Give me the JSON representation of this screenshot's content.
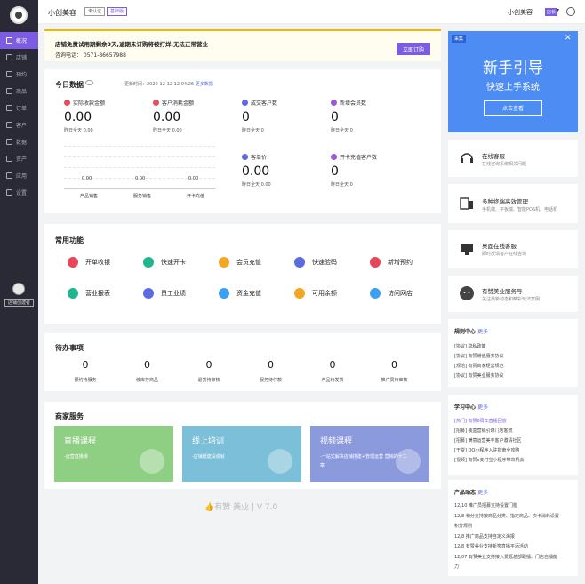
{
  "sidebar": {
    "items": [
      {
        "label": "概况"
      },
      {
        "label": "店铺"
      },
      {
        "label": "预约"
      },
      {
        "label": "商品"
      },
      {
        "label": "订单"
      },
      {
        "label": "客户"
      },
      {
        "label": "数据"
      },
      {
        "label": "资产"
      },
      {
        "label": "应用"
      },
      {
        "label": "设置"
      }
    ],
    "bottom_button": "店铺创建者"
  },
  "header": {
    "shop_name": "小创美容",
    "tag_unverified": "未认证",
    "tag_version": "基础版",
    "user_name": "小创美容",
    "user_badge": "店长"
  },
  "notice": {
    "text": "店铺免费试用期剩余3天,逾期未订购将被打烊,无法正常营业",
    "phone": "咨询电话： 0571-86657988",
    "button": "立即订购"
  },
  "today": {
    "title": "今日数据",
    "update_time": "更新时间：2020-12-12 12:04:26",
    "more": "更多数据",
    "metrics": [
      {
        "label": "实际收款金额",
        "value": "0.00",
        "sub": "昨日全天  0.00",
        "color": "#e84d5b"
      },
      {
        "label": "客户消耗金额",
        "value": "0.00",
        "sub": "昨日全天  0.00",
        "color": "#e84d5b"
      },
      {
        "label": "成交客户数",
        "value": "0",
        "sub": "昨日全天  0",
        "color": "#5b6be0"
      },
      {
        "label": "新增会员数",
        "value": "0",
        "sub": "昨日全天  0",
        "color": "#9b59d6"
      },
      {
        "label": "客单价",
        "value": "0.00",
        "sub": "昨日全天  0.00",
        "color": "#5b6be0"
      },
      {
        "label": "开卡充值客户数",
        "value": "0",
        "sub": "昨日全天  0",
        "color": "#9b59d6"
      }
    ]
  },
  "chart_data": {
    "type": "bar",
    "categories": [
      "产品销售",
      "服务销售",
      "开卡充值"
    ],
    "values": [
      0,
      0,
      0
    ],
    "value_labels": [
      "0.00",
      "0.00",
      "0.00"
    ],
    "title": "",
    "xlabel": "",
    "ylabel": ""
  },
  "functions": {
    "title": "常用功能",
    "items": [
      {
        "label": "开单收银",
        "color": "#e8455a"
      },
      {
        "label": "快速开卡",
        "color": "#1fb58f"
      },
      {
        "label": "会员充值",
        "color": "#f5a623"
      },
      {
        "label": "快速验码",
        "color": "#5b6be0"
      },
      {
        "label": "新增预约",
        "color": "#e8455a"
      },
      {
        "label": "营业报表",
        "color": "#1fb58f"
      },
      {
        "label": "员工业绩",
        "color": "#5b6be0"
      },
      {
        "label": "资金充值",
        "color": "#3da0f0"
      },
      {
        "label": "可用余额",
        "color": "#f5a623"
      },
      {
        "label": "访问网店",
        "color": "#3da0f0"
      }
    ]
  },
  "todo": {
    "title": "待办事项",
    "items": [
      {
        "count": "0",
        "label": "预约待服务"
      },
      {
        "count": "0",
        "label": "低库存商品"
      },
      {
        "count": "0",
        "label": "退货待审核"
      },
      {
        "count": "0",
        "label": "服务待付款"
      },
      {
        "count": "0",
        "label": "产品待发货"
      },
      {
        "count": "0",
        "label": "推广员待审核"
      }
    ]
  },
  "services": {
    "title": "商家服务",
    "banners": [
      {
        "title": "直播课程",
        "desc": "-运营直播课",
        "color": "#8fcf84"
      },
      {
        "title": "线上培训",
        "desc": "-店铺纸建设成就",
        "color": "#7bbfd8"
      },
      {
        "title": "视频课程",
        "desc": "-一站式解决店铺搭建+管理运营 营销的十二章",
        "color": "#8b99dd"
      }
    ]
  },
  "footer": {
    "brand": "有赞 美业",
    "version": "V 7.0"
  },
  "guide": {
    "tag": "采集",
    "title": "新手引导",
    "subtitle": "快速上手系统",
    "button": "点击查看"
  },
  "right_cards": [
    {
      "title": "在线客服",
      "desc": "在线咨询系统相关问题"
    },
    {
      "title": "多种终端高效管理",
      "desc": "手机端、平板端、智能POS机、电话机"
    },
    {
      "title": "桌面在线客服",
      "desc": "即时反馈客户在线咨询"
    },
    {
      "title": "有赞美业服务号",
      "desc": "关注最新动态和精彩玩法案例"
    }
  ],
  "rules": {
    "title": "规则中心",
    "more": "更多",
    "items": [
      "[协议] 隐私政策",
      "[协议] 有赞增值服务协议",
      "[规范] 有赞商家经营规范",
      "[协议] 有赞美业服务协议"
    ]
  },
  "learning": {
    "title": "学习中心",
    "more": "更多",
    "items": [
      "[热门] 有赞6周年直播回放",
      "[招募] 装盒营销引爆门店客流",
      "[招募] 满意运营美丰客户邀请社区",
      "[干货] QQ小程序入驻指南全攻略",
      "[视频] 有赞x支付宝小程序带来机会"
    ]
  },
  "product_news": {
    "title": "产品动态",
    "more": "更多",
    "items": [
      "12/10 推广员招募支持设置门槛",
      "12/8 积分支持按商品分类、指定商品、次卡消耗设置",
      "积分规则",
      "12/8 推广商品支持自定义海报",
      "12/8 有赞美业支持新签直播平添活动",
      "12/07 有赞美业支持接入爱逛总部联播、门店自播能",
      "力"
    ]
  }
}
